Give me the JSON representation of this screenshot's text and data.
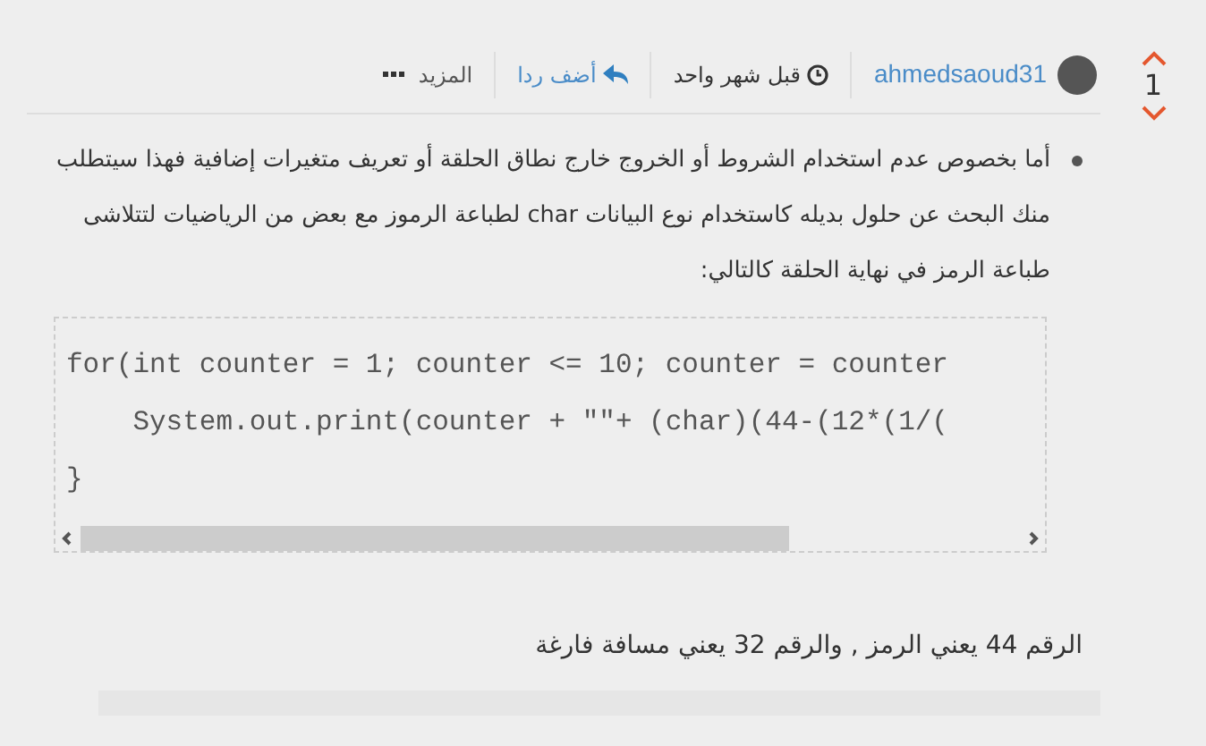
{
  "vote": {
    "count": "1"
  },
  "header": {
    "username": "ahmedsaoud31",
    "time": "قبل شهر واحد",
    "reply": "أضف ردا",
    "more": "المزيد"
  },
  "bullet": "أما بخصوص عدم استخدام الشروط أو الخروج خارج نطاق الحلقة أو تعريف متغيرات إضافية فهذا سيتطلب منك البحث عن حلول بديله كاستخدام نوع البيانات char لطباعة الرموز مع بعض من الرياضيات لتتلاشى طباعة الرمز في نهاية الحلقة كالتالي:",
  "code_lines": [
    "for(int counter = 1; counter <= 10; counter = counter",
    "    System.out.print(counter + \"\"+ (char)(44-(12*(1/(",
    "}"
  ],
  "note": "الرقم 44 يعني الرمز , والرقم 32 يعني مسافة فارغة"
}
